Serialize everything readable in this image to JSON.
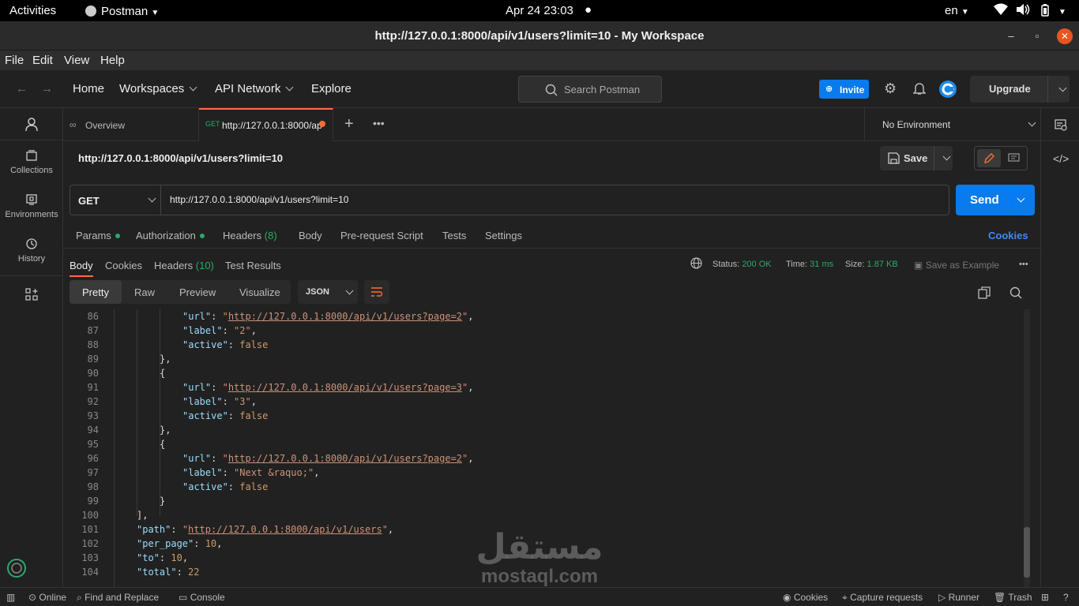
{
  "gnome": {
    "activities": "Activities",
    "app_name": "Postman",
    "clock": "Apr 24  23:03",
    "lang": "en"
  },
  "window": {
    "title": "http://127.0.0.1:8000/api/v1/users?limit=10 - My Workspace"
  },
  "menu": [
    "File",
    "Edit",
    "View",
    "Help"
  ],
  "header": {
    "home": "Home",
    "workspaces": "Workspaces",
    "api_network": "API Network",
    "explore": "Explore",
    "search_placeholder": "Search Postman",
    "invite": "Invite",
    "upgrade": "Upgrade"
  },
  "sidebar": {
    "items": [
      {
        "label": "Collections",
        "icon": "collections-icon"
      },
      {
        "label": "Environments",
        "icon": "environments-icon"
      },
      {
        "label": "History",
        "icon": "history-icon"
      }
    ]
  },
  "tabs": {
    "overview": "Overview",
    "active_method": "GET",
    "active_url": "http://127.0.0.1:8000/ap",
    "environment": "No Environment"
  },
  "request": {
    "title": "http://127.0.0.1:8000/api/v1/users?limit=10",
    "save": "Save",
    "method": "GET",
    "url": "http://127.0.0.1:8000/api/v1/users?limit=10",
    "send": "Send",
    "tabs": {
      "params": "Params",
      "authorization": "Authorization",
      "headers": "Headers",
      "headers_count": "(8)",
      "body": "Body",
      "prerequest": "Pre-request Script",
      "tests": "Tests",
      "settings": "Settings",
      "cookies": "Cookies"
    }
  },
  "response": {
    "tabs": {
      "body": "Body",
      "cookies": "Cookies",
      "headers": "Headers",
      "headers_count": "(10)",
      "test_results": "Test Results"
    },
    "status_label": "Status:",
    "status_value": "200 OK",
    "time_label": "Time:",
    "time_value": "31 ms",
    "size_label": "Size:",
    "size_value": "1.87 KB",
    "save_example": "Save as Example",
    "views": [
      "Pretty",
      "Raw",
      "Preview",
      "Visualize"
    ],
    "format": "JSON"
  },
  "code_lines": [
    {
      "n": "86",
      "indent": 4,
      "key": "url",
      "url": "http://127.0.0.1:8000/api/v1/users?page=2",
      "tail": ","
    },
    {
      "n": "87",
      "indent": 4,
      "key": "label",
      "str": "2",
      "tail": ","
    },
    {
      "n": "88",
      "indent": 4,
      "key": "active",
      "val": "false",
      "tail": ""
    },
    {
      "n": "89",
      "indent": 3,
      "plain": "},"
    },
    {
      "n": "90",
      "indent": 3,
      "plain": "{"
    },
    {
      "n": "91",
      "indent": 4,
      "key": "url",
      "url": "http://127.0.0.1:8000/api/v1/users?page=3",
      "tail": ","
    },
    {
      "n": "92",
      "indent": 4,
      "key": "label",
      "str": "3",
      "tail": ","
    },
    {
      "n": "93",
      "indent": 4,
      "key": "active",
      "val": "false",
      "tail": ""
    },
    {
      "n": "94",
      "indent": 3,
      "plain": "},"
    },
    {
      "n": "95",
      "indent": 3,
      "plain": "{"
    },
    {
      "n": "96",
      "indent": 4,
      "key": "url",
      "url": "http://127.0.0.1:8000/api/v1/users?page=2",
      "tail": ","
    },
    {
      "n": "97",
      "indent": 4,
      "key": "label",
      "str": "Next &raquo;",
      "tail": ","
    },
    {
      "n": "98",
      "indent": 4,
      "key": "active",
      "val": "false",
      "tail": ""
    },
    {
      "n": "99",
      "indent": 3,
      "plain": "}"
    },
    {
      "n": "100",
      "indent": 2,
      "plain": "],"
    },
    {
      "n": "101",
      "indent": 2,
      "key": "path",
      "url": "http://127.0.0.1:8000/api/v1/users",
      "tail": ","
    },
    {
      "n": "102",
      "indent": 2,
      "key": "per_page",
      "val": "10",
      "tail": ","
    },
    {
      "n": "103",
      "indent": 2,
      "key": "to",
      "val": "10",
      "tail": ","
    },
    {
      "n": "104",
      "indent": 2,
      "key": "total",
      "val": "22",
      "tail": ""
    }
  ],
  "statusbar": {
    "online": "Online",
    "find_replace": "Find and Replace",
    "console": "Console",
    "cookies": "Cookies",
    "capture": "Capture requests",
    "runner": "Runner",
    "trash": "Trash"
  },
  "watermark": {
    "arabic": "مستقل",
    "latin": "mostaql.com"
  }
}
